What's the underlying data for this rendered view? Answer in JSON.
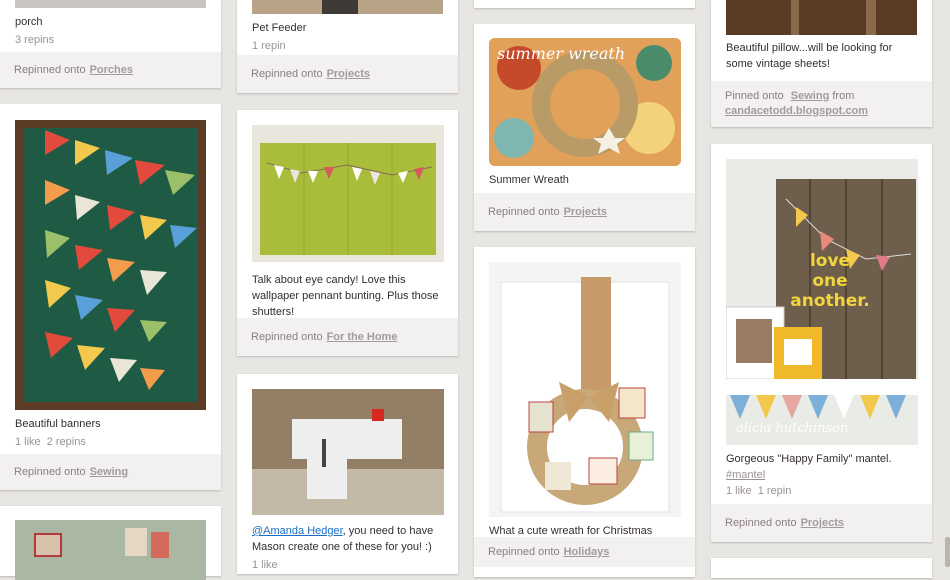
{
  "pins": {
    "porch": {
      "desc": "porch",
      "repins": "3 repins",
      "action": "Repinned onto",
      "board": "Porches"
    },
    "pet_feeder": {
      "desc": "Pet Feeder",
      "repins": "1 repin",
      "action": "Repinned onto",
      "board": "Projects"
    },
    "summer_wreath_top": {
      "action": "Repinned onto",
      "board": "Projects"
    },
    "pillow": {
      "desc": "Beautiful pillow...will be looking for some vintage sheets!",
      "action": "Pinned onto",
      "board": "Sewing",
      "from_word": "from",
      "source": "candacetodd.blogspot.com"
    },
    "banners": {
      "desc": "Beautiful banners",
      "likes": "1 like",
      "repins": "2 repins",
      "action": "Repinned onto",
      "board": "Sewing"
    },
    "shutters": {
      "desc": "Talk about eye candy! Love this wallpaper pennant bunting. Plus those shutters!",
      "action": "Repinned onto",
      "board": "For the Home"
    },
    "summer_wreath": {
      "desc": "Summer Wreath",
      "overlay": "summer wreath",
      "action": "Repinned onto",
      "board": "Projects"
    },
    "mantel": {
      "desc": "Gorgeous \"Happy Family\" mantel.",
      "hashtag": "#mantel",
      "likes": "1 like",
      "repins": "1 repin",
      "action": "Repinned onto",
      "board": "Projects",
      "sign_line1": "love",
      "sign_line2": "one",
      "sign_line3": "another.",
      "watermark": "alicia hutchinson"
    },
    "lego": {
      "mention": "@Amanda Hedger",
      "desc_rest": ", you need to have Mason create one of these for you! :)",
      "likes": "1 like"
    },
    "christmas_wreath": {
      "desc": "What a cute wreath for Christmas",
      "action": "Repinned onto",
      "board": "Holidays"
    }
  },
  "colors": {
    "page_bg": "#e8e6e3",
    "card_bg": "#ffffff",
    "footer_bg": "#f2f0f0",
    "link": "#1a6fc4"
  }
}
